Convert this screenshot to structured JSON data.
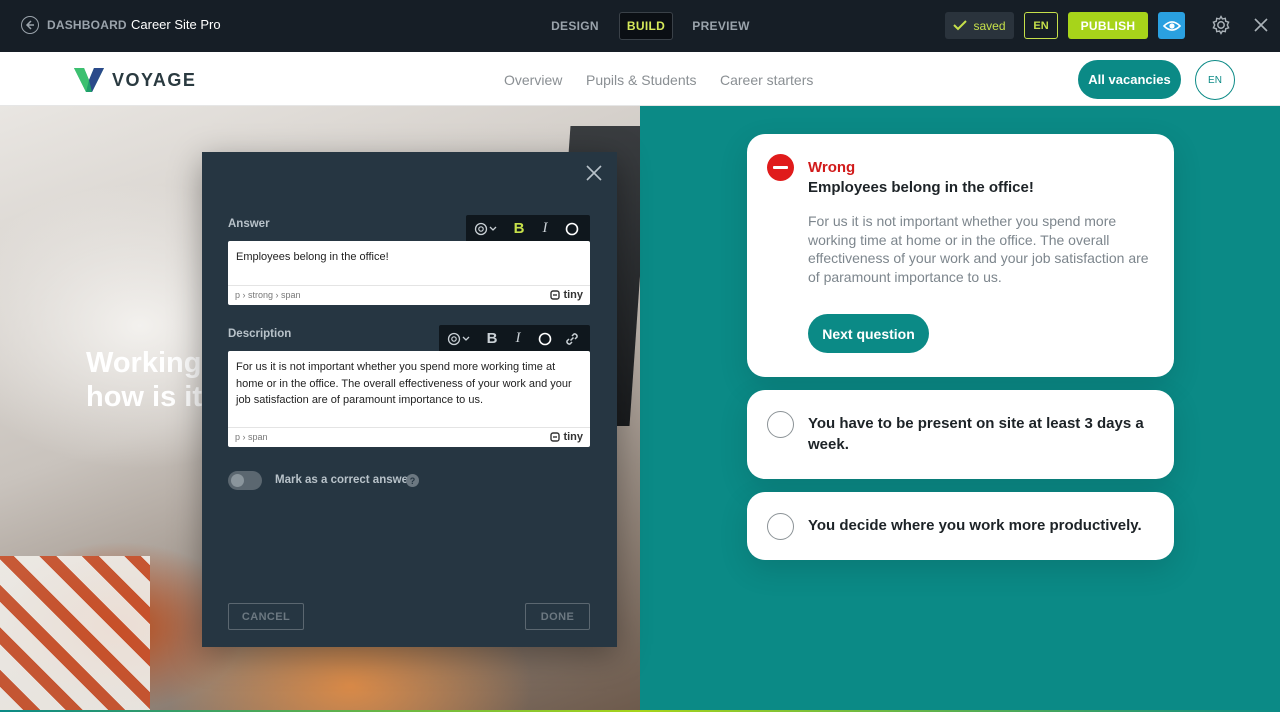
{
  "topbar": {
    "dashboard_label": "DASHBOARD",
    "site_name": "Career Site Pro",
    "modes": [
      "DESIGN",
      "BUILD",
      "PREVIEW"
    ],
    "active_mode": "BUILD",
    "saved_label": "saved",
    "language": "EN",
    "publish_label": "PUBLISH",
    "icons": [
      "back-icon",
      "check-icon",
      "eye-icon",
      "gear-icon",
      "close-icon"
    ]
  },
  "sitenav": {
    "brand": "VOYAGE",
    "links": [
      "Overview",
      "Pupils & Students",
      "Career starters"
    ],
    "cta": "All vacancies",
    "language": "EN"
  },
  "hero": {
    "heading_line1": "Working",
    "heading_line2": "how is it"
  },
  "quiz": {
    "result_label": "Wrong",
    "selected_answer": "Employees belong in the office!",
    "selected_description": "For us it is not important whether you spend more working time at home or in the office. The overall effectiveness of your work and your job satisfaction are of paramount importance to us.",
    "next_label": "Next question",
    "options": [
      "You have to be present on site at least 3 days a week.",
      "You decide where you work more productively."
    ]
  },
  "modal": {
    "answer_label": "Answer",
    "answer_value": "Employees belong in the office!",
    "answer_path": "p › strong › span",
    "description_label": "Description",
    "description_value": "For us it is not important whether you spend more working time at home or in the office. The overall effectiveness of your work and your job satisfaction are of paramount importance to us.",
    "description_path": "p › span",
    "tiny_label": "tiny",
    "toolbar_bold": "B",
    "toolbar_italic": "I",
    "toggle_label": "Mark as a correct answer",
    "toggle_on": false,
    "help": "?",
    "cancel_label": "CANCEL",
    "done_label": "DONE"
  },
  "colors": {
    "topbar_bg": "#161e26",
    "accent_lime": "#a7d41a",
    "brand_teal": "#0b8a86",
    "wrong_red": "#e01b1b",
    "modal_bg": "#263642"
  }
}
